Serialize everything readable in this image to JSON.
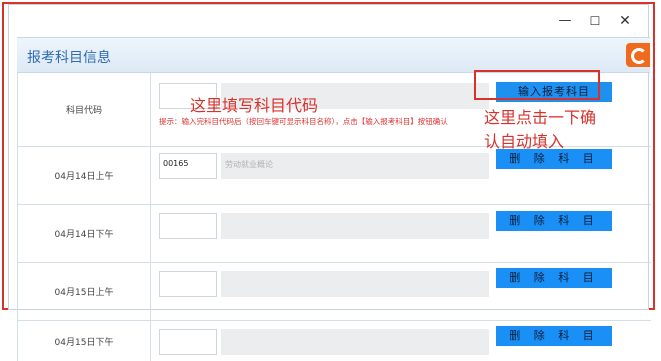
{
  "window": {
    "controls": {
      "minimize": "—",
      "maximize": "☐",
      "close": "✕"
    }
  },
  "section": {
    "title": "报考科目信息"
  },
  "rows": [
    {
      "label": "科目代码",
      "code": "",
      "name": "",
      "button": "输入报考科目",
      "hint": "提示：输入完科目代码后（按回车键可显示科目名称），点击【输入报考科目】按钮确认"
    },
    {
      "label": "04月14日上午",
      "code": "00165",
      "name": "劳动就业概论",
      "button": "删 除 科 目"
    },
    {
      "label": "04月14日下午",
      "code": "",
      "name": "",
      "button": "删 除 科 目"
    },
    {
      "label": "04月15日上午",
      "code": "",
      "name": "",
      "button": "删 除 科 目"
    },
    {
      "label": "04月15日下午",
      "code": "",
      "name": "",
      "button": "删 除 科 目"
    }
  ],
  "annotations": {
    "fill_code": "这里填写科目代码",
    "click_confirm_line1": "这里点击一下确",
    "click_confirm_line2": "认自动填入"
  },
  "colors": {
    "accent_blue": "#1a8ff5",
    "annotation_red": "#d8322c",
    "header_text": "#2e6cb5"
  }
}
